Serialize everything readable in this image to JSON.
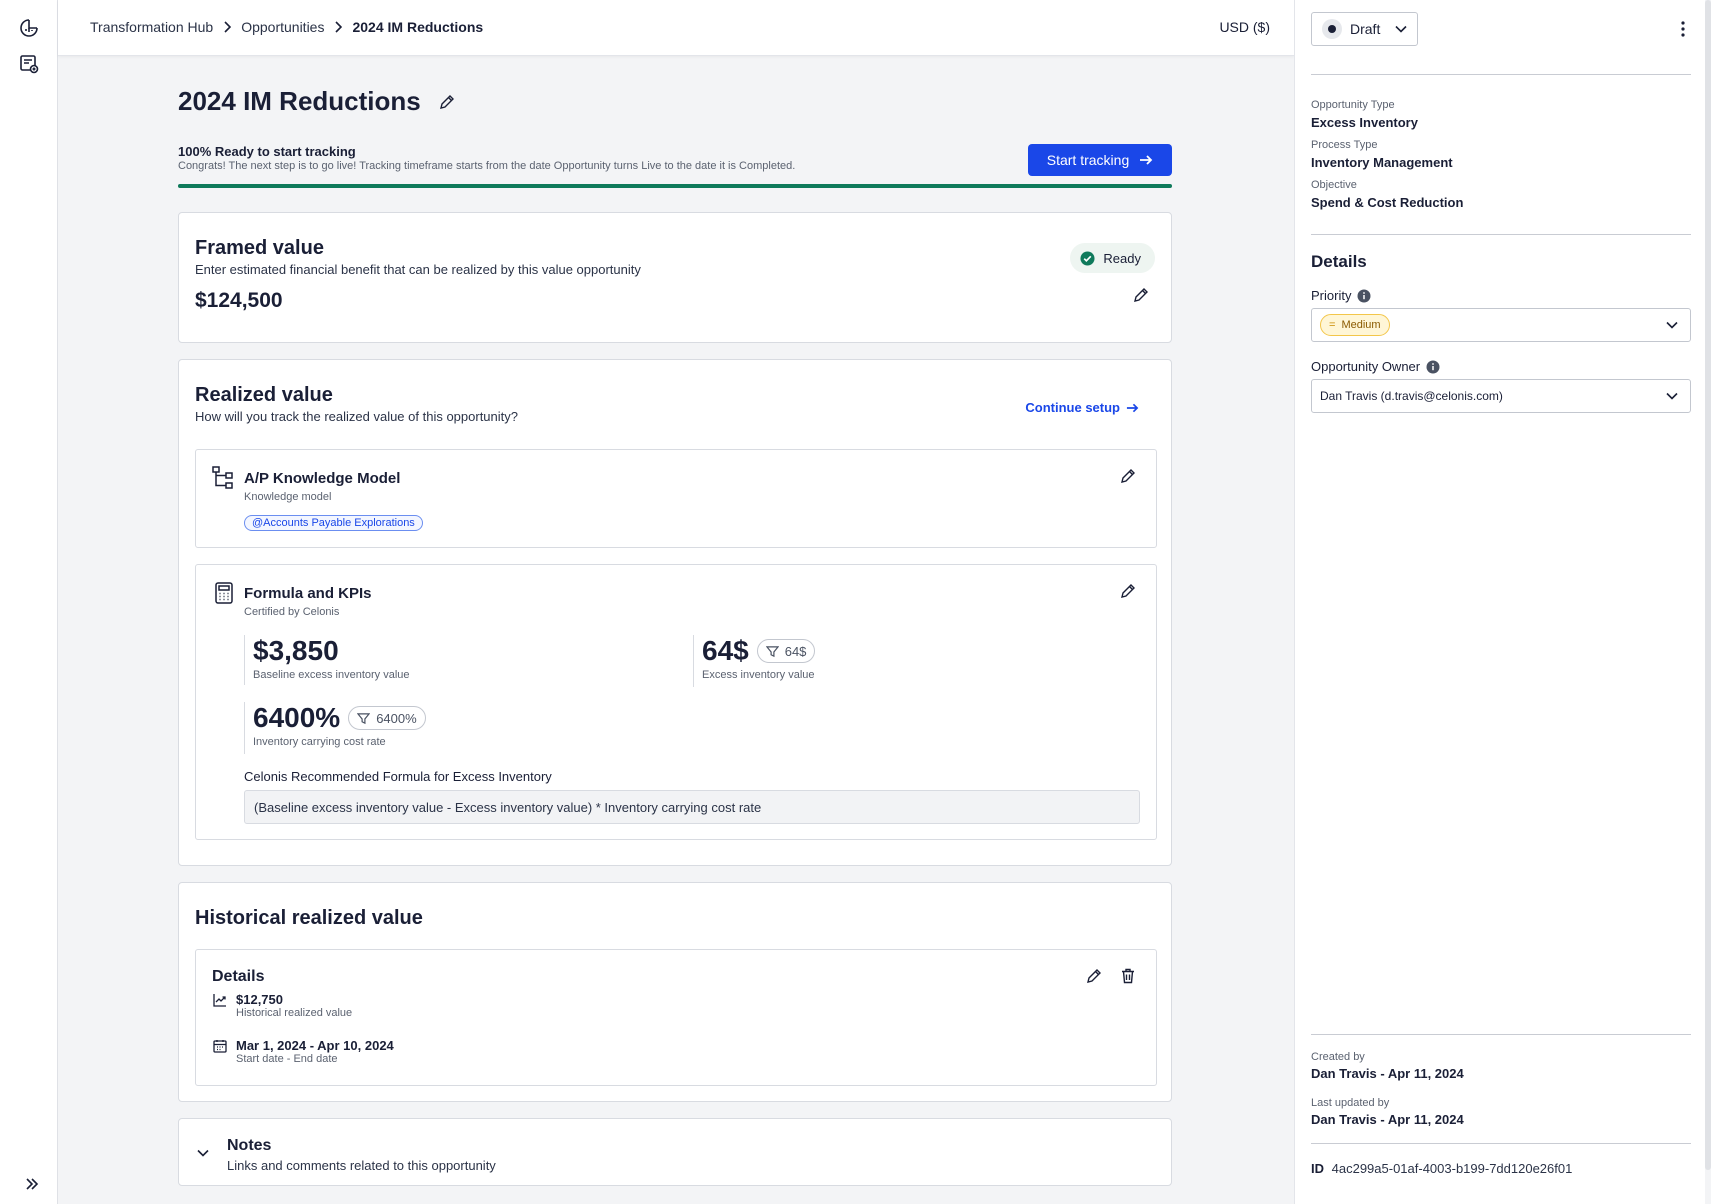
{
  "topbar": {
    "breadcrumb": [
      "Transformation Hub",
      "Opportunities",
      "2024 IM Reductions"
    ],
    "currency": "USD ($)"
  },
  "page": {
    "title": "2024 IM Reductions"
  },
  "readiness": {
    "title": "100% Ready to start tracking",
    "subtitle": "Congrats! The next step is to go live! Tracking timeframe starts from the date Opportunity turns Live to the date it is Completed.",
    "button_label": "Start tracking",
    "progress_percent": 100,
    "progress_color": "#0f7a5b"
  },
  "framed_value": {
    "title": "Framed value",
    "subtitle": "Enter estimated financial benefit that can be realized by this value opportunity",
    "value": "$124,500",
    "status": "Ready"
  },
  "realized_value": {
    "title": "Realized value",
    "subtitle": "How will you track the realized value of this opportunity?",
    "continue_label": "Continue setup",
    "knowledge_model": {
      "title": "A/P Knowledge Model",
      "subtitle": "Knowledge model",
      "tag": "@Accounts Payable Explorations"
    },
    "formula": {
      "title": "Formula and KPIs",
      "subtitle": "Certified by Celonis",
      "kpis": [
        {
          "value": "$3,850",
          "label": "Baseline excess inventory value"
        },
        {
          "value": "64$",
          "chip": "64$",
          "label": "Excess inventory value"
        },
        {
          "value": "6400%",
          "chip": "6400%",
          "label": "Inventory carrying cost rate"
        }
      ],
      "formula_label": "Celonis Recommended Formula for Excess Inventory",
      "formula_text": "(Baseline excess inventory value - Excess inventory value) * Inventory carrying cost rate"
    }
  },
  "historical": {
    "title": "Historical realized value",
    "details_title": "Details",
    "value": "$12,750",
    "value_label": "Historical realized value",
    "date_range": "Mar 1, 2024 - Apr 10, 2024",
    "date_label": "Start date - End date"
  },
  "notes": {
    "title": "Notes",
    "subtitle": "Links and comments related to this opportunity"
  },
  "right_panel": {
    "status": "Draft",
    "opportunity_type_label": "Opportunity Type",
    "opportunity_type": "Excess Inventory",
    "process_type_label": "Process Type",
    "process_type": "Inventory Management",
    "objective_label": "Objective",
    "objective": "Spend & Cost Reduction",
    "details_heading": "Details",
    "priority_label": "Priority",
    "priority_value": "Medium",
    "owner_label": "Opportunity Owner",
    "owner_value": "Dan Travis (d.travis@celonis.com)",
    "created_by_label": "Created by",
    "created_by": "Dan Travis - Apr 11, 2024",
    "updated_by_label": "Last updated by",
    "updated_by": "Dan Travis - Apr 11, 2024",
    "id_label": "ID",
    "id_value": "4ac299a5-01af-4003-b199-7dd120e26f01"
  },
  "icons": {
    "rail": [
      "dashboard-icon",
      "add-list-icon",
      "expand-icon"
    ],
    "primary_color": "#1a47e8"
  }
}
